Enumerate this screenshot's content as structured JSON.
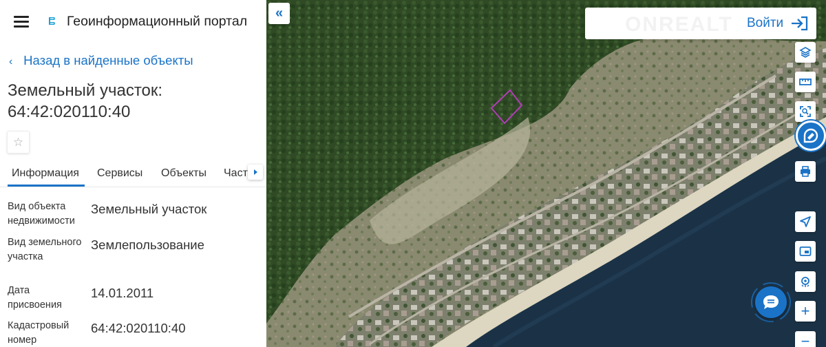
{
  "header": {
    "menu_icon": "hamburger-icon",
    "logo_icon": "portal-logo-icon",
    "title": "Геоинформационный портал"
  },
  "nav": {
    "back_chevron": "‹",
    "back_label": "Назад в найденные объекты"
  },
  "object": {
    "title_line1": "Земельный участок:",
    "title_line2": "64:42:020110:40",
    "favorite_icon": "☆"
  },
  "tabs": [
    {
      "label": "Информация",
      "active": true
    },
    {
      "label": "Сервисы",
      "active": false
    },
    {
      "label": "Объекты",
      "active": false
    },
    {
      "label": "Части",
      "active": false
    }
  ],
  "details": [
    {
      "label": "Вид объекта недвижимости",
      "value": "Земельный участок"
    },
    {
      "label": "Вид земельного участка",
      "value": "Землепользование"
    },
    {
      "label": "Дата присвоения",
      "value": "14.01.2011"
    },
    {
      "label": "Кадастровый номер",
      "value": "64:42:020110:40"
    }
  ],
  "map": {
    "collapse_icon": "«",
    "login_label": "Войти",
    "watermark": "ONREALT",
    "tools": [
      "layers-icon",
      "ruler-icon",
      "area-select-icon",
      "rosreestr-icon",
      "print-icon",
      "navigate-icon",
      "fullscreen-icon",
      "location-icon",
      "zoom-in-icon",
      "zoom-out-icon"
    ],
    "zoom_in_label": "+",
    "zoom_out_label": "−"
  },
  "colors": {
    "accent": "#1a73c7",
    "parcel_outline": "#b23cb8",
    "forest": "#2c4a22",
    "water": "#1b3246",
    "sand": "#d9d1b8"
  }
}
